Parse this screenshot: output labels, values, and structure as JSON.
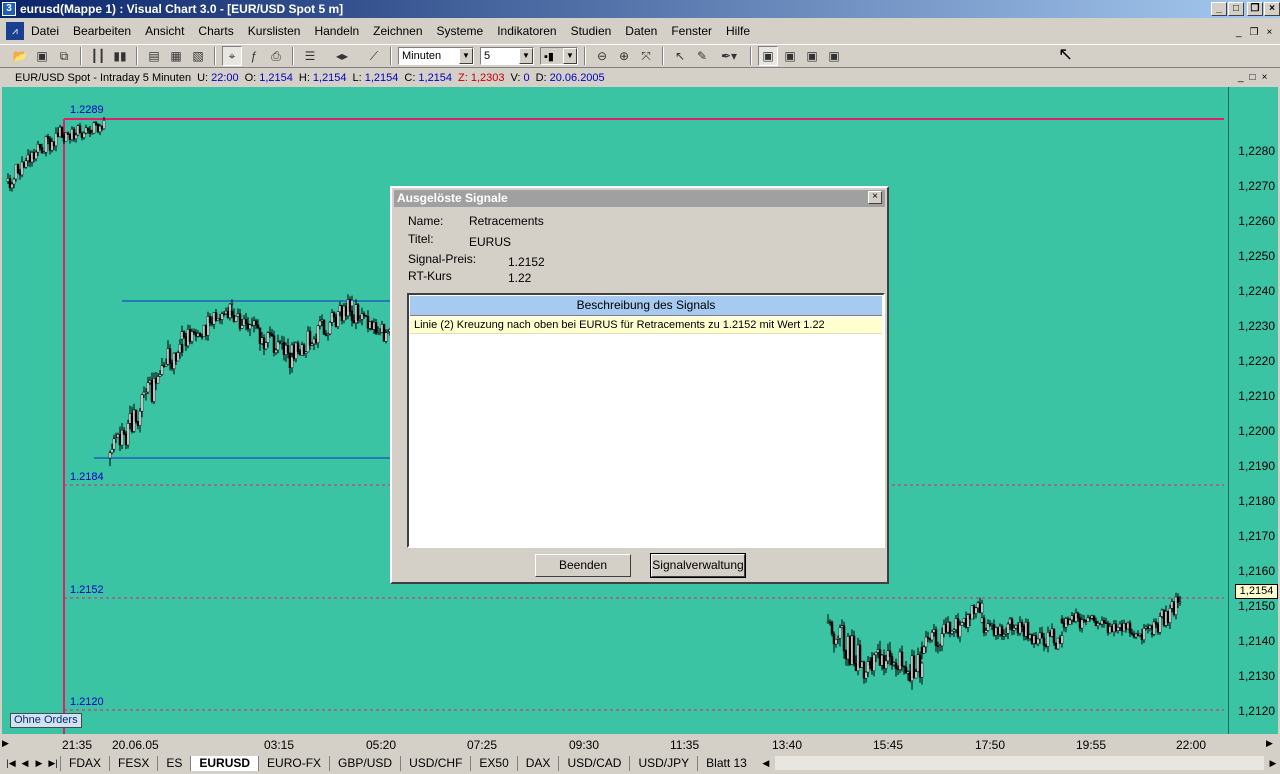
{
  "window": {
    "title": "eurusd(Mappe 1) : Visual Chart  3.0 - [EUR/USD Spot 5 m]",
    "app_icon": "3"
  },
  "menu": [
    "Datei",
    "Bearbeiten",
    "Ansicht",
    "Charts",
    "Kurslisten",
    "Handeln",
    "Zeichnen",
    "Systeme",
    "Indikatoren",
    "Studien",
    "Daten",
    "Fenster",
    "Hilfe"
  ],
  "toolbar": {
    "period_unit": "Minuten",
    "period_value": "5"
  },
  "chart_header": {
    "symbol": "EUR/USD Spot - Intraday 5 Minuten",
    "u_label": "U:",
    "u_value": "22:00",
    "o_label": "O:",
    "o_value": "1,2154",
    "h_label": "H:",
    "h_value": "1,2154",
    "l_label": "L:",
    "l_value": "1,2154",
    "c_label": "C:",
    "c_value": "1,2154",
    "z_label": "Z:",
    "z_value": "1,2303",
    "v_label": "V:",
    "v_value": "0",
    "d_label": "D:",
    "d_value": "20.06.2005"
  },
  "chart_data": {
    "type": "candlestick",
    "y_ticks": [
      "1,2280",
      "1,2270",
      "1,2260",
      "1,2250",
      "1,2240",
      "1,2230",
      "1,2220",
      "1,2210",
      "1,2200",
      "1,2190",
      "1,2180",
      "1,2170",
      "1,2160",
      "1,2150",
      "1,2140",
      "1,2130",
      "1,2120"
    ],
    "x_ticks": [
      "21:35",
      "20.06.05",
      "03:15",
      "05:20",
      "07:25",
      "09:30",
      "11:35",
      "13:40",
      "15:45",
      "17:50",
      "19:55",
      "22:00"
    ],
    "current_price": "1,2154",
    "level_labels": {
      "top": "1.2289",
      "mid": "1.2184",
      "signal": "1.2152",
      "low": "1.2120"
    }
  },
  "orders_badge": "Ohne Orders",
  "tabs": [
    "FDAX",
    "FESX",
    "ES",
    "EURUSD",
    "EURO-FX",
    "GBP/USD",
    "USD/CHF",
    "EX50",
    "DAX",
    "USD/CAD",
    "USD/JPY",
    "Blatt 13"
  ],
  "active_tab": "EURUSD",
  "dialog": {
    "title": "Ausgelöste Signale",
    "name_label": "Name:",
    "name_value": "Retracements",
    "titel_label": "Titel:",
    "titel_value": "EURUS",
    "preis_label": "Signal-Preis:",
    "preis_value": "1.2152",
    "kurs_label": "RT-Kurs",
    "kurs_value": "1.22",
    "table_header": "Beschreibung des Signals",
    "table_row": "Linie (2) Kreuzung nach oben bei EURUS für Retracements zu 1.2152 mit Wert 1.22",
    "btn_end": "Beenden",
    "btn_manage": "Signalverwaltung"
  }
}
